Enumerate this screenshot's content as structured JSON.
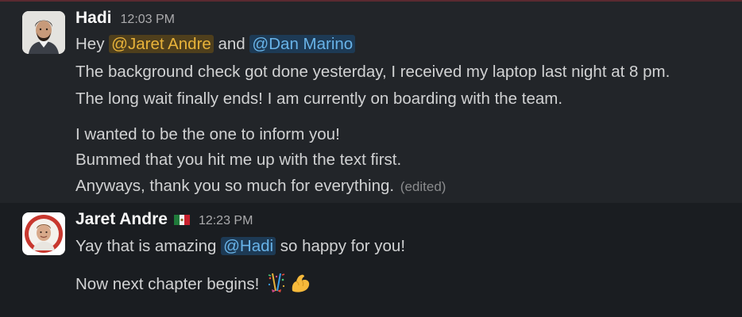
{
  "messages": [
    {
      "author": "Hadi",
      "time": "12:03 PM",
      "lines": {
        "l1": {
          "prefix": "Hey ",
          "mention1": "@Jaret Andre",
          "middle": " and ",
          "mention2": "@Dan Marino"
        },
        "l2": "The background check got done yesterday, I received my laptop last night at 8 pm.",
        "l3": "The long wait finally ends! I am currently on boarding with the team.",
        "l4": "I wanted to be the one to inform you!",
        "l5": "Bummed that you hit me up with the text first.",
        "l6": "Anyways, thank you so much for everything.",
        "edited": "(edited)"
      }
    },
    {
      "author": "Jaret Andre",
      "status_emoji": "mexico-flag",
      "time": "12:23 PM",
      "lines": {
        "l1": {
          "prefix": "Yay that is amazing ",
          "mention": "@Hadi",
          "suffix": " so happy for you!"
        },
        "l2": "Now next chapter begins!"
      },
      "emojis": [
        "confetti-icon",
        "flexed-biceps-icon"
      ]
    }
  ],
  "colors": {
    "background": "#1a1d21",
    "highlighted_row": "#222529",
    "mention_self": "#e8b33a",
    "mention_other": "#68b3e8"
  }
}
